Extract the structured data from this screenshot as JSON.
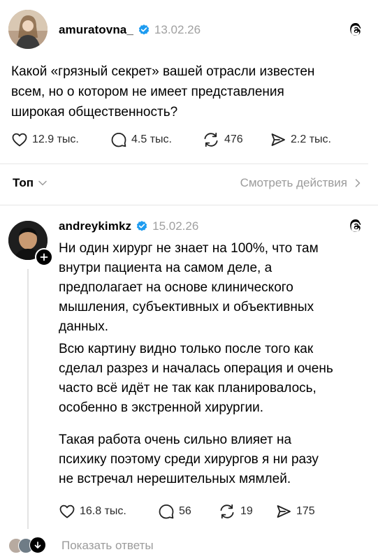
{
  "post": {
    "username": "amuratovna_",
    "date": "13.02.26",
    "text_lines": [
      "Какой «грязный секрет» вашей отрасли известен",
      "всем, но о котором не имеет представления",
      "широкая общественность?"
    ],
    "actions": {
      "likes": "12.9 тыс.",
      "comments": "4.5 тыс.",
      "reposts": "476",
      "shares": "2.2 тыс."
    }
  },
  "sort_bar": {
    "sort_label": "Топ",
    "view_activity": "Смотреть действия"
  },
  "reply": {
    "username": "andreykimkz",
    "date": "15.02.26",
    "paragraph1_lines": [
      "Ни один хирург не знает на 100%, что там",
      "внутри пациента на самом деле, а",
      "предполагает на основе клинического",
      "мышления, субъективных и объективных",
      "данных.",
      "Всю картину видно только после того как",
      "сделал разрез и началась операция и очень",
      "часто всё идёт не так как планировалось,",
      "особенно в экстренной хирургии."
    ],
    "paragraph2_lines": [
      "Такая работа очень сильно влияет на",
      "психику поэтому среди хирургов я ни разу",
      "не встречал нерешительных мямлей."
    ],
    "actions": {
      "likes": "16.8 тыс.",
      "comments": "56",
      "reposts": "19",
      "shares": "175"
    }
  },
  "show_replies": "Показать ответы",
  "colors": {
    "verified": "#1d9bf0",
    "muted": "#9b9b9b",
    "divider": "#e6e6e6"
  }
}
